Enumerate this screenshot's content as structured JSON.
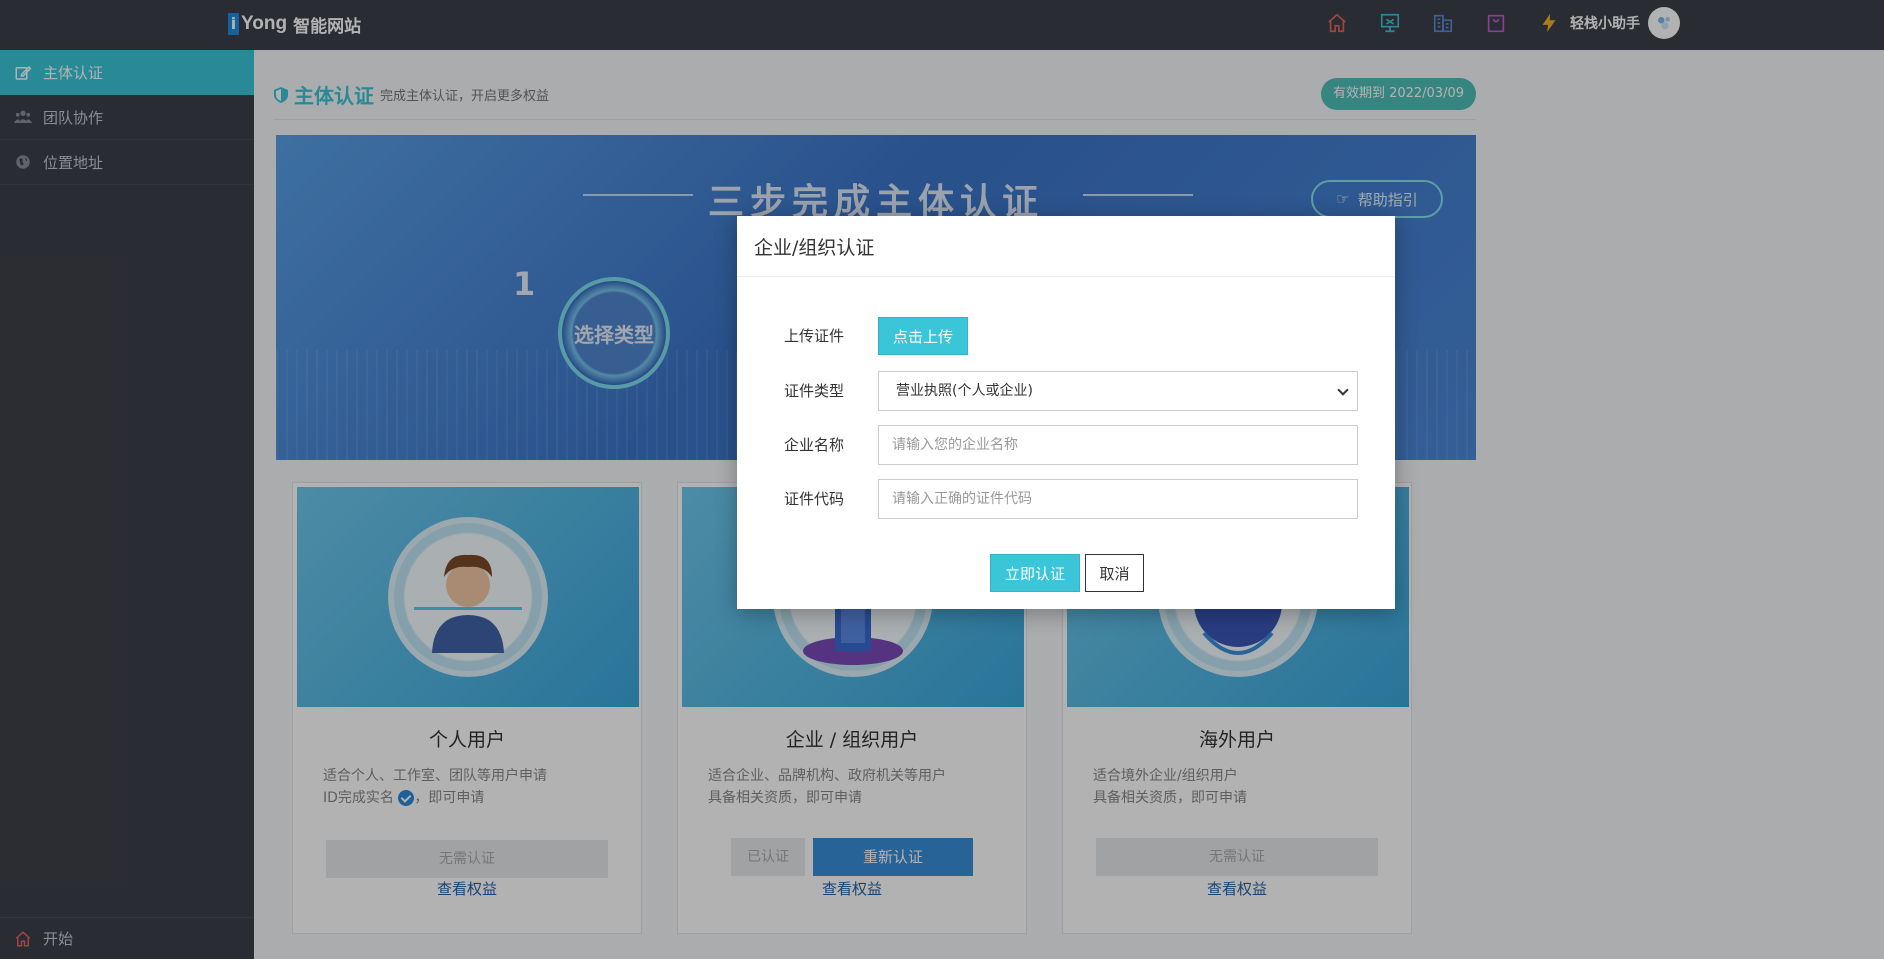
{
  "topbar": {
    "logo_mark": "i",
    "logo_brand": "Yong",
    "logo_sub": "智能网站",
    "icons": [
      {
        "name": "home-icon",
        "color": "#e2655f"
      },
      {
        "name": "monitor-icon",
        "color": "#3ac6d8"
      },
      {
        "name": "building-icon",
        "color": "#5a8ad8"
      },
      {
        "name": "bag-icon",
        "color": "#c85ad8"
      },
      {
        "name": "lightning-icon",
        "color": "#f5b025"
      }
    ],
    "assistant_label": "轻栈小助手"
  },
  "sidebar": {
    "items": [
      {
        "label": "主体认证",
        "icon": "edit-icon",
        "active": true
      },
      {
        "label": "团队协作",
        "icon": "users-icon",
        "active": false
      },
      {
        "label": "位置地址",
        "icon": "globe-icon",
        "active": false
      }
    ],
    "bottom_label": "开始"
  },
  "page": {
    "title": "主体认证",
    "subtitle": "完成主体认证，开启更多权益",
    "valid_badge": "有效期到 2022/03/09"
  },
  "banner": {
    "title": "三步完成主体认证",
    "help_label": "帮助指引",
    "step_number": "1",
    "step_label": "选择类型"
  },
  "cards": [
    {
      "title": "个人用户",
      "desc_line1": "适合个人、工作室、团队等用户申请",
      "desc_line2_a": "ID完成实名",
      "desc_line2_b": "，即可申请",
      "button": "无需认证",
      "link": "查看权益"
    },
    {
      "title": "企业 / 组织用户",
      "desc_line1": "适合企业、品牌机构、政府机关等用户",
      "desc_line2": "具备相关资质，即可申请",
      "verified_label": "已认证",
      "reverify_label": "重新认证",
      "link": "查看权益"
    },
    {
      "title": "海外用户",
      "desc_line1": "适合境外企业/组织用户",
      "desc_line2": "具备相关资质，即可申请",
      "button": "无需认证",
      "link": "查看权益"
    }
  ],
  "modal": {
    "title": "企业/组织认证",
    "upload_label": "上传证件",
    "upload_button": "点击上传",
    "type_label": "证件类型",
    "type_value": "营业执照(个人或企业)",
    "name_label": "企业名称",
    "name_placeholder": "请输入您的企业名称",
    "code_label": "证件代码",
    "code_placeholder": "请输入正确的证件代码",
    "submit_label": "立即认证",
    "cancel_label": "取消"
  },
  "colors": {
    "accent": "#3ac6d8",
    "sidebar_bg": "#3d4049",
    "primary_blue": "#3a8ed8"
  }
}
